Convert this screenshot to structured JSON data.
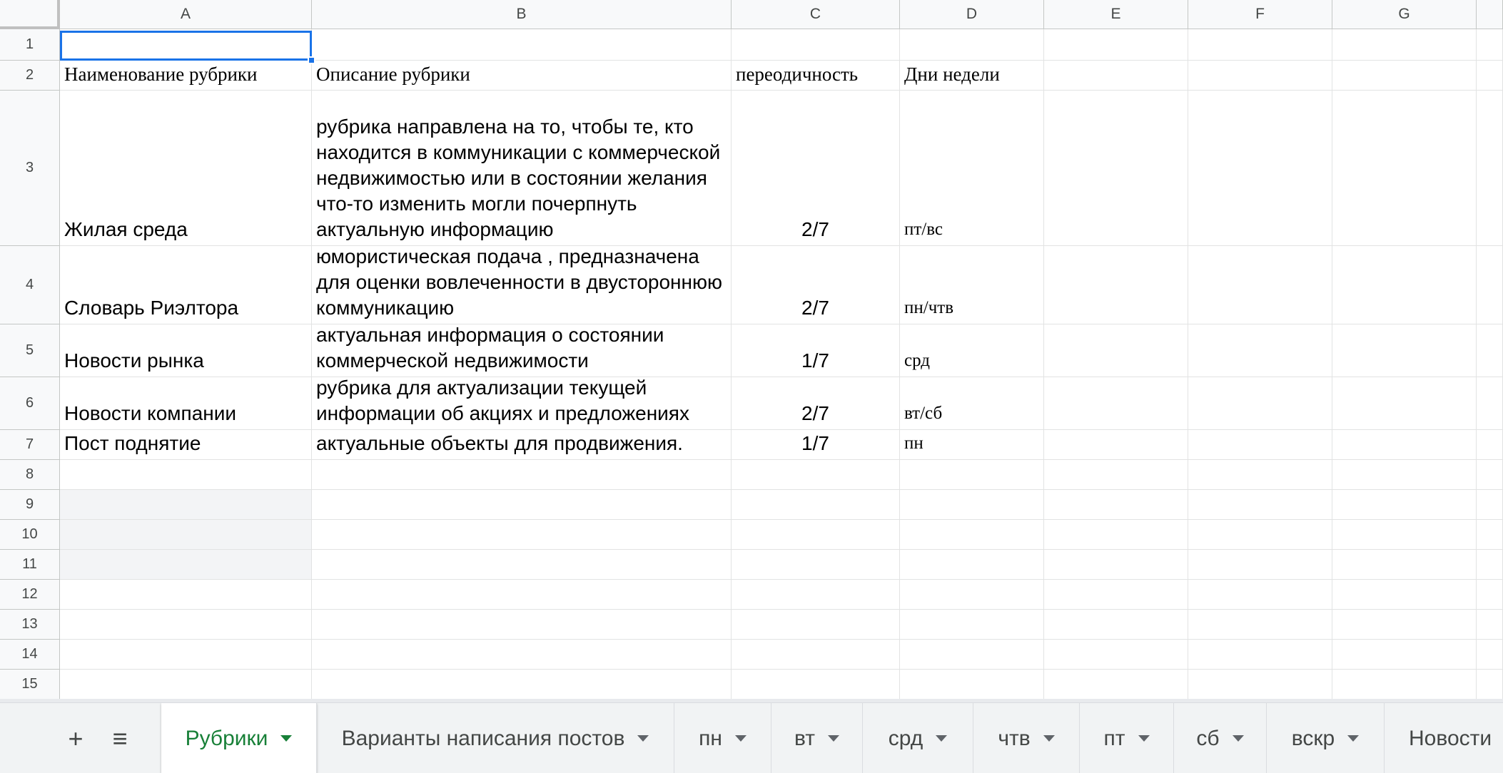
{
  "columns": [
    "A",
    "B",
    "C",
    "D",
    "E",
    "F",
    "G"
  ],
  "rows": [
    "1",
    "2",
    "3",
    "4",
    "5",
    "6",
    "7",
    "8",
    "9",
    "10",
    "11",
    "12",
    "13",
    "14",
    "15"
  ],
  "cells": {
    "A2": "Наименование рубрики",
    "B2": "Описание рубрики",
    "C2": "переодичность",
    "D2": "Дни недели",
    "A3": "Жилая среда",
    "B3": "рубрика направлена на то, чтобы те, кто находится в коммуникации с коммерческой недвижимостью или в состоянии желания что-то изменить могли почерпнуть актуальную информацию",
    "C3": "2/7",
    "D3": "пт/вс",
    "A4": "Словарь Риэлтора",
    "B4": "юмористическая подача , предназначена для оценки вовлеченности в двустороннюю коммуникацию",
    "C4": "2/7",
    "D4": "пн/чтв",
    "A5": "Новости рынка",
    "B5": "актуальная информация о состоянии коммерческой недвижимости",
    "C5": "1/7",
    "D5": "срд",
    "A6": "Новости компании",
    "B6": "рубрика для актуализации текущей информации об акциях и предложениях",
    "C6": "2/7",
    "D6": "вт/сб",
    "A7": "Пост поднятие",
    "B7": "актуальные объекты для продвижения.",
    "C7": "1/7",
    "D7": "пн"
  },
  "selected_cell": "A1",
  "tabbar": {
    "add_label": "+",
    "all_sheets_label": "≡",
    "tabs": [
      {
        "label": "Рубрики",
        "active": true
      },
      {
        "label": "Варианты написания постов",
        "active": false
      },
      {
        "label": "пн",
        "active": false
      },
      {
        "label": "вт",
        "active": false
      },
      {
        "label": "срд",
        "active": false
      },
      {
        "label": "чтв",
        "active": false
      },
      {
        "label": "пт",
        "active": false
      },
      {
        "label": "сб",
        "active": false
      },
      {
        "label": "вскр",
        "active": false
      },
      {
        "label": "Новости",
        "active": false
      }
    ]
  },
  "colors": {
    "accent": "#1a73e8",
    "active_tab_text": "#188038",
    "header_bg": "#f8f9fa",
    "grid_line": "#e2e3e3"
  }
}
